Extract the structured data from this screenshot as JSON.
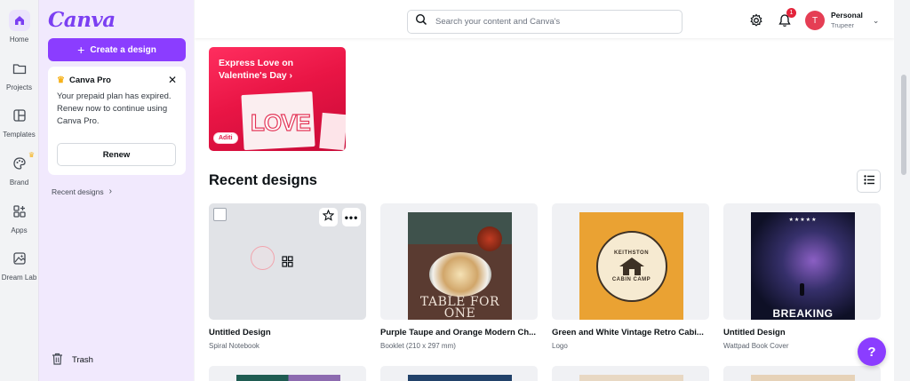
{
  "rail": {
    "items": [
      {
        "label": "Home",
        "icon": "home-icon"
      },
      {
        "label": "Projects",
        "icon": "folder-icon"
      },
      {
        "label": "Templates",
        "icon": "templates-icon"
      },
      {
        "label": "Brand",
        "icon": "brand-icon"
      },
      {
        "label": "Apps",
        "icon": "apps-icon"
      },
      {
        "label": "Dream Lab",
        "icon": "dream-lab-icon"
      }
    ]
  },
  "panel": {
    "logo": "Canva",
    "create_label": "Create a design",
    "pro": {
      "title": "Canva Pro",
      "message": "Your prepaid plan has expired. Renew now to continue using Canva Pro.",
      "renew_label": "Renew"
    },
    "recent_label": "Recent designs",
    "trash_label": "Trash"
  },
  "topbar": {
    "search_placeholder": "Search your content and Canva's",
    "notification_count": "1",
    "account": {
      "initial": "T",
      "name": "Personal",
      "sub": "Trupeer"
    }
  },
  "banner": {
    "title": "Express Love on Valentine's Day",
    "art_text": "LOVE",
    "art_name": "Aditi"
  },
  "main": {
    "section_title": "Recent designs"
  },
  "designs": [
    {
      "name": "Untitled Design",
      "type": "Spiral Notebook"
    },
    {
      "name": "Purple Taupe and Orange Modern Ch...",
      "type": "Booklet (210 x 297 mm)",
      "art_text": "TABLE FOR ONE"
    },
    {
      "name": "Green and White Vintage Retro Cabi...",
      "type": "Logo",
      "art_top": "KEITHSTON",
      "art_bottom": "CABIN CAMP"
    },
    {
      "name": "Untitled Design",
      "type": "Wattpad Book Cover",
      "art_text": "BREAKING"
    }
  ],
  "help_label": "?",
  "colors": {
    "accent": "#8b3dff",
    "panel_bg": "#f1e9fd",
    "banner_red": "#e91545"
  }
}
